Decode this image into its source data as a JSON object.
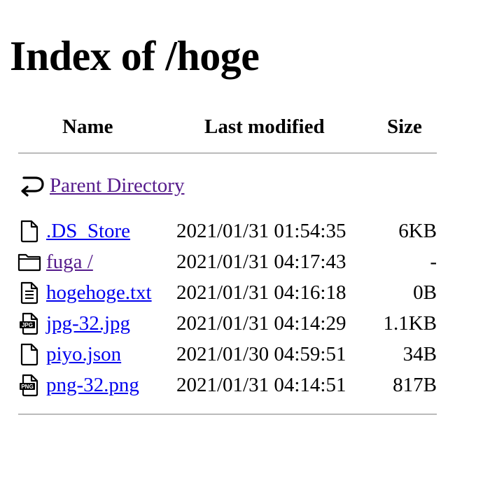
{
  "title": "Index of /hoge",
  "columns": {
    "name": "Name",
    "last_modified": "Last modified",
    "size": "Size"
  },
  "parent": {
    "label": "Parent Directory",
    "icon": "back-arrow-icon"
  },
  "files": [
    {
      "name": ".DS_Store",
      "modified": "2021/01/31 01:54:35",
      "size": "6KB",
      "icon": "file-icon"
    },
    {
      "name": "fuga /",
      "modified": "2021/01/31 04:17:43",
      "size": "-",
      "icon": "folder-icon"
    },
    {
      "name": "hogehoge.txt",
      "modified": "2021/01/31 04:16:18",
      "size": "0B",
      "icon": "text-file-icon"
    },
    {
      "name": "jpg-32.jpg",
      "modified": "2021/01/31 04:14:29",
      "size": "1.1KB",
      "icon": "jpg-file-icon",
      "badge": "JPG"
    },
    {
      "name": "piyo.json",
      "modified": "2021/01/30 04:59:51",
      "size": "34B",
      "icon": "file-icon"
    },
    {
      "name": "png-32.png",
      "modified": "2021/01/31 04:14:51",
      "size": "817B",
      "icon": "png-file-icon",
      "badge": "PNG"
    }
  ],
  "colors": {
    "link": "#0000ee",
    "visited": "#551a8b",
    "rule": "#9a9a9a"
  }
}
